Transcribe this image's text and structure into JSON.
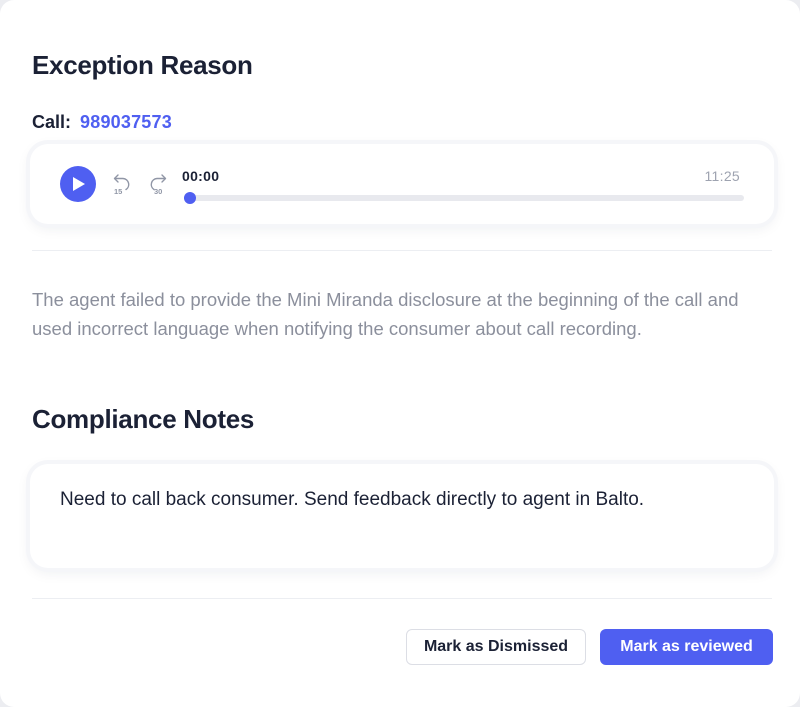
{
  "exception": {
    "title": "Exception Reason",
    "call_label": "Call:",
    "call_id": "989037573",
    "reason": "The agent failed to provide the Mini Miranda disclosure at the beginning of the call and used incorrect language when notifying the consumer about call recording."
  },
  "player": {
    "current_time": "00:00",
    "total_time": "11:25",
    "progress_fraction": 0.01,
    "skip_back_seconds": "15",
    "skip_forward_seconds": "30",
    "icons": [
      "play-icon",
      "rewind-15-icon",
      "forward-30-icon"
    ]
  },
  "compliance": {
    "title": "Compliance Notes",
    "notes": "Need to call back consumer. Send feedback directly to agent in Balto."
  },
  "actions": {
    "dismiss_label": "Mark as Dismissed",
    "reviewed_label": "Mark as reviewed"
  },
  "colors": {
    "accent": "#4f5ff1",
    "heading": "#1b2135",
    "muted": "#8b8f9c"
  }
}
